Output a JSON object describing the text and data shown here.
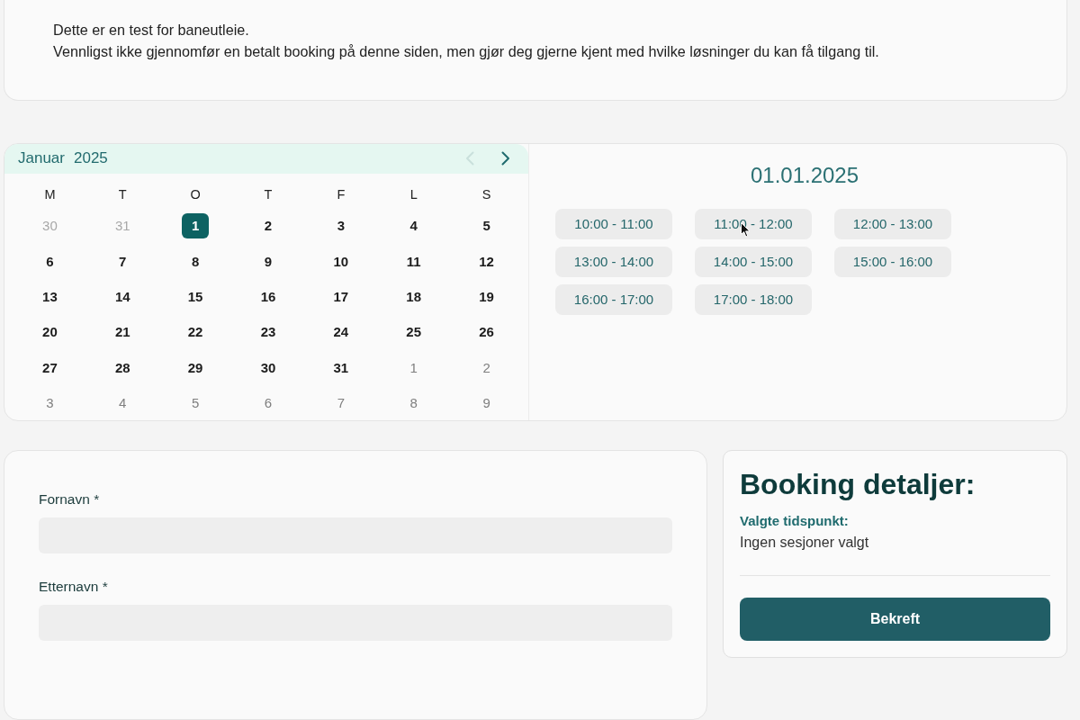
{
  "notice": {
    "lines": [
      "Dette er en test for baneutleie.",
      "Vennligst ikke gjennomfør en betalt booking på denne siden, men gjør deg gjerne kjent med hvilke løsninger du kan få tilgang til."
    ]
  },
  "calendar": {
    "month": "Januar",
    "year": "2025",
    "prev": {
      "disabled": true
    },
    "next": {
      "disabled": false
    },
    "weekdays": [
      "M",
      "T",
      "O",
      "T",
      "F",
      "L",
      "S"
    ],
    "weeks": [
      [
        {
          "day": "30",
          "kind": "previous",
          "selected": false
        },
        {
          "day": "31",
          "kind": "previous",
          "selected": false
        },
        {
          "day": "1",
          "kind": "current",
          "selected": true
        },
        {
          "day": "2",
          "kind": "current",
          "selected": false
        },
        {
          "day": "3",
          "kind": "current",
          "selected": false
        },
        {
          "day": "4",
          "kind": "current",
          "selected": false
        },
        {
          "day": "5",
          "kind": "current",
          "selected": false
        }
      ],
      [
        {
          "day": "6",
          "kind": "current",
          "selected": false
        },
        {
          "day": "7",
          "kind": "current",
          "selected": false
        },
        {
          "day": "8",
          "kind": "current",
          "selected": false
        },
        {
          "day": "9",
          "kind": "current",
          "selected": false
        },
        {
          "day": "10",
          "kind": "current",
          "selected": false
        },
        {
          "day": "11",
          "kind": "current",
          "selected": false
        },
        {
          "day": "12",
          "kind": "current",
          "selected": false
        }
      ],
      [
        {
          "day": "13",
          "kind": "current",
          "selected": false
        },
        {
          "day": "14",
          "kind": "current",
          "selected": false
        },
        {
          "day": "15",
          "kind": "current",
          "selected": false
        },
        {
          "day": "16",
          "kind": "current",
          "selected": false
        },
        {
          "day": "17",
          "kind": "current",
          "selected": false
        },
        {
          "day": "18",
          "kind": "current",
          "selected": false
        },
        {
          "day": "19",
          "kind": "current",
          "selected": false
        }
      ],
      [
        {
          "day": "20",
          "kind": "current",
          "selected": false
        },
        {
          "day": "21",
          "kind": "current",
          "selected": false
        },
        {
          "day": "22",
          "kind": "current",
          "selected": false
        },
        {
          "day": "23",
          "kind": "current",
          "selected": false
        },
        {
          "day": "24",
          "kind": "current",
          "selected": false
        },
        {
          "day": "25",
          "kind": "current",
          "selected": false
        },
        {
          "day": "26",
          "kind": "current",
          "selected": false
        }
      ],
      [
        {
          "day": "27",
          "kind": "current",
          "selected": false
        },
        {
          "day": "28",
          "kind": "current",
          "selected": false
        },
        {
          "day": "29",
          "kind": "current",
          "selected": false
        },
        {
          "day": "30",
          "kind": "current",
          "selected": false
        },
        {
          "day": "31",
          "kind": "current",
          "selected": false
        },
        {
          "day": "1",
          "kind": "following",
          "selected": false
        },
        {
          "day": "2",
          "kind": "following",
          "selected": false
        }
      ],
      [
        {
          "day": "3",
          "kind": "following",
          "selected": false
        },
        {
          "day": "4",
          "kind": "following",
          "selected": false
        },
        {
          "day": "5",
          "kind": "following",
          "selected": false
        },
        {
          "day": "6",
          "kind": "following",
          "selected": false
        },
        {
          "day": "7",
          "kind": "following",
          "selected": false
        },
        {
          "day": "8",
          "kind": "following",
          "selected": false
        },
        {
          "day": "9",
          "kind": "following",
          "selected": false
        }
      ]
    ]
  },
  "schedule": {
    "date": "01.01.2025",
    "slots": [
      {
        "label": "10:00 - 11:00",
        "selected": false
      },
      {
        "label": "11:00 - 12:00",
        "selected": false
      },
      {
        "label": "12:00 - 13:00",
        "selected": false
      },
      {
        "label": "13:00 - 14:00",
        "selected": false
      },
      {
        "label": "14:00 - 15:00",
        "selected": false
      },
      {
        "label": "15:00 - 16:00",
        "selected": false
      },
      {
        "label": "16:00 - 17:00",
        "selected": false
      },
      {
        "label": "17:00 - 18:00",
        "selected": false
      }
    ]
  },
  "form": {
    "fields": [
      {
        "label": "Fornavn *"
      },
      {
        "label": "Etternavn *"
      }
    ]
  },
  "booking": {
    "title": "Booking detaljer:",
    "selected_label": "Valgte tidspunkt:",
    "selected_value": "Ingen sesjoner valgt",
    "button": "Bekreft"
  }
}
